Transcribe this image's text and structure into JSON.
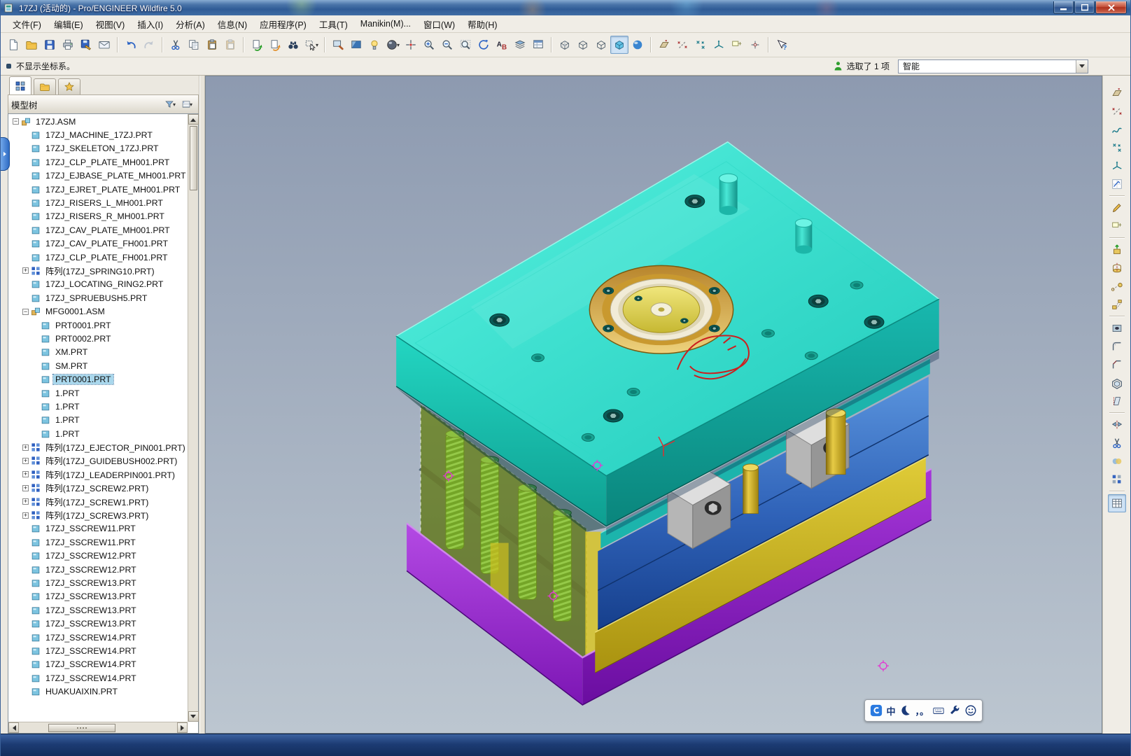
{
  "window": {
    "title": "17ZJ (活动的) - Pro/ENGINEER Wildfire 5.0",
    "controls": [
      {
        "name": "minimize-button",
        "glyph": "minimize"
      },
      {
        "name": "maximize-button",
        "glyph": "maximize"
      },
      {
        "name": "close-button",
        "glyph": "close"
      }
    ]
  },
  "menu_bar": {
    "items": [
      "文件(F)",
      "编辑(E)",
      "视图(V)",
      "插入(I)",
      "分析(A)",
      "信息(N)",
      "应用程序(P)",
      "工具(T)",
      "Manikin(M)...",
      "窗口(W)",
      "帮助(H)"
    ]
  },
  "toolbar": {
    "buttons": [
      {
        "name": "new-file-button",
        "icon": "page"
      },
      {
        "name": "open-button",
        "icon": "folder"
      },
      {
        "name": "save-button",
        "icon": "floppy"
      },
      {
        "name": "print-button",
        "icon": "printer"
      },
      {
        "name": "save-copy-button",
        "icon": "floppypen"
      },
      {
        "name": "send-mail-button",
        "icon": "mail"
      },
      {
        "sep": true
      },
      {
        "name": "undo-button",
        "icon": "undo"
      },
      {
        "name": "redo-button",
        "icon": "redo",
        "disabled": true
      },
      {
        "sep": true
      },
      {
        "name": "cut-button",
        "icon": "cut"
      },
      {
        "name": "copy-button",
        "icon": "copy"
      },
      {
        "name": "paste-button",
        "icon": "paste"
      },
      {
        "name": "paste-special-button",
        "icon": "paste",
        "disabled": true
      },
      {
        "sep": true
      },
      {
        "name": "regenerate-button",
        "icon": "regen"
      },
      {
        "name": "regen-manager-button",
        "icon": "regen2"
      },
      {
        "name": "find-button",
        "icon": "binoculars"
      },
      {
        "name": "select-box-button",
        "icon": "selbox",
        "dropdown": true
      },
      {
        "sep": true
      },
      {
        "name": "repaint-button",
        "icon": "repaint"
      },
      {
        "name": "shading-button",
        "icon": "shade"
      },
      {
        "name": "enhanced-realism-button",
        "icon": "spotlight"
      },
      {
        "name": "render-style-button",
        "icon": "sphere",
        "dropdown": true
      },
      {
        "name": "spin-center-button",
        "icon": "spin"
      },
      {
        "name": "zoom-in-button",
        "icon": "zoomin"
      },
      {
        "name": "zoom-out-button",
        "icon": "zoomout"
      },
      {
        "name": "refit-button",
        "icon": "refit"
      },
      {
        "name": "reorient-button",
        "icon": "orient"
      },
      {
        "name": "annotation-ab-button",
        "icon": "ab"
      },
      {
        "name": "layers-button",
        "icon": "layers"
      },
      {
        "name": "view-manager-button",
        "icon": "viewmgr"
      },
      {
        "sep": true
      },
      {
        "name": "wireframe-button",
        "icon": "cubew"
      },
      {
        "name": "hidden-line-button",
        "icon": "cubeh"
      },
      {
        "name": "no-hidden-button",
        "icon": "cuben"
      },
      {
        "name": "shaded-button",
        "icon": "cubes",
        "active": true
      },
      {
        "name": "realism-button",
        "icon": "ball"
      },
      {
        "sep": true
      },
      {
        "name": "datum-planes-toggle",
        "icon": "dplane"
      },
      {
        "name": "datum-axes-toggle",
        "icon": "daxis"
      },
      {
        "name": "datum-points-toggle",
        "icon": "dpoint"
      },
      {
        "name": "datum-csys-toggle",
        "icon": "dcsys"
      },
      {
        "name": "annotation-display-toggle",
        "icon": "dnote"
      },
      {
        "name": "spin-center-toggle",
        "icon": "dspin"
      },
      {
        "sep": true
      },
      {
        "name": "context-help-button",
        "icon": "help"
      }
    ]
  },
  "status_bar": {
    "message": "不显示坐标系。",
    "selection_status": "选取了 1 项",
    "selection_filter": {
      "label": "智能"
    }
  },
  "navigator": {
    "tabs": [
      {
        "name": "model-tree-tab",
        "icon": "treeicon",
        "active": true
      },
      {
        "name": "folder-browser-tab",
        "icon": "folder",
        "active": false
      },
      {
        "name": "favorites-tab",
        "icon": "star",
        "active": false
      }
    ],
    "header": {
      "title": "模型树",
      "buttons": [
        {
          "name": "tree-filters-button",
          "icon": "funnel"
        },
        {
          "name": "tree-columns-button",
          "icon": "listcols"
        }
      ]
    },
    "tree": [
      {
        "label": "17ZJ.ASM",
        "level": 0,
        "icon": "asm",
        "exp": "-"
      },
      {
        "label": "17ZJ_MACHINE_17ZJ.PRT",
        "level": 1,
        "icon": "prt",
        "exp": ""
      },
      {
        "label": "17ZJ_SKELETON_17ZJ.PRT",
        "level": 1,
        "icon": "prt",
        "exp": ""
      },
      {
        "label": "17ZJ_CLP_PLATE_MH001.PRT",
        "level": 1,
        "icon": "prt",
        "exp": ""
      },
      {
        "label": "17ZJ_EJBASE_PLATE_MH001.PRT",
        "level": 1,
        "icon": "prt",
        "exp": ""
      },
      {
        "label": "17ZJ_EJRET_PLATE_MH001.PRT",
        "level": 1,
        "icon": "prt",
        "exp": ""
      },
      {
        "label": "17ZJ_RISERS_L_MH001.PRT",
        "level": 1,
        "icon": "prt",
        "exp": ""
      },
      {
        "label": "17ZJ_RISERS_R_MH001.PRT",
        "level": 1,
        "icon": "prt",
        "exp": ""
      },
      {
        "label": "17ZJ_CAV_PLATE_MH001.PRT",
        "level": 1,
        "icon": "prt",
        "exp": ""
      },
      {
        "label": "17ZJ_CAV_PLATE_FH001.PRT",
        "level": 1,
        "icon": "prt",
        "exp": ""
      },
      {
        "label": "17ZJ_CLP_PLATE_FH001.PRT",
        "level": 1,
        "icon": "prt",
        "exp": ""
      },
      {
        "label": "阵列(17ZJ_SPRING10.PRT)",
        "level": 1,
        "icon": "pattern",
        "exp": "+"
      },
      {
        "label": "17ZJ_LOCATING_RING2.PRT",
        "level": 1,
        "icon": "prt",
        "exp": ""
      },
      {
        "label": "17ZJ_SPRUEBUSH5.PRT",
        "level": 1,
        "icon": "prt",
        "exp": ""
      },
      {
        "label": "MFG0001.ASM",
        "level": 1,
        "icon": "asm",
        "exp": "-"
      },
      {
        "label": "PRT0001.PRT",
        "level": 2,
        "icon": "prt",
        "exp": ""
      },
      {
        "label": "PRT0002.PRT",
        "level": 2,
        "icon": "prt",
        "exp": ""
      },
      {
        "label": "XM.PRT",
        "level": 2,
        "icon": "prt",
        "exp": ""
      },
      {
        "label": "SM.PRT",
        "level": 2,
        "icon": "prt",
        "exp": ""
      },
      {
        "label": "PRT0001.PRT",
        "level": 2,
        "icon": "prt",
        "exp": "",
        "selected": true
      },
      {
        "label": "1.PRT",
        "level": 2,
        "icon": "prt",
        "exp": ""
      },
      {
        "label": "1.PRT",
        "level": 2,
        "icon": "prt",
        "exp": ""
      },
      {
        "label": "1.PRT",
        "level": 2,
        "icon": "prt",
        "exp": ""
      },
      {
        "label": "1.PRT",
        "level": 2,
        "icon": "prt",
        "exp": ""
      },
      {
        "label": "阵列(17ZJ_EJECTOR_PIN001.PRT)",
        "level": 1,
        "icon": "pattern",
        "exp": "+"
      },
      {
        "label": "阵列(17ZJ_GUIDEBUSH002.PRT)",
        "level": 1,
        "icon": "pattern",
        "exp": "+"
      },
      {
        "label": "阵列(17ZJ_LEADERPIN001.PRT)",
        "level": 1,
        "icon": "pattern",
        "exp": "+"
      },
      {
        "label": "阵列(17ZJ_SCREW2.PRT)",
        "level": 1,
        "icon": "pattern",
        "exp": "+"
      },
      {
        "label": "阵列(17ZJ_SCREW1.PRT)",
        "level": 1,
        "icon": "pattern",
        "exp": "+"
      },
      {
        "label": "阵列(17ZJ_SCREW3.PRT)",
        "level": 1,
        "icon": "pattern",
        "exp": "+"
      },
      {
        "label": "17ZJ_SSCREW11.PRT",
        "level": 1,
        "icon": "prt",
        "exp": ""
      },
      {
        "label": "17ZJ_SSCREW11.PRT",
        "level": 1,
        "icon": "prt",
        "exp": ""
      },
      {
        "label": "17ZJ_SSCREW12.PRT",
        "level": 1,
        "icon": "prt",
        "exp": ""
      },
      {
        "label": "17ZJ_SSCREW12.PRT",
        "level": 1,
        "icon": "prt",
        "exp": ""
      },
      {
        "label": "17ZJ_SSCREW13.PRT",
        "level": 1,
        "icon": "prt",
        "exp": ""
      },
      {
        "label": "17ZJ_SSCREW13.PRT",
        "level": 1,
        "icon": "prt",
        "exp": ""
      },
      {
        "label": "17ZJ_SSCREW13.PRT",
        "level": 1,
        "icon": "prt",
        "exp": ""
      },
      {
        "label": "17ZJ_SSCREW13.PRT",
        "level": 1,
        "icon": "prt",
        "exp": ""
      },
      {
        "label": "17ZJ_SSCREW14.PRT",
        "level": 1,
        "icon": "prt",
        "exp": ""
      },
      {
        "label": "17ZJ_SSCREW14.PRT",
        "level": 1,
        "icon": "prt",
        "exp": ""
      },
      {
        "label": "17ZJ_SSCREW14.PRT",
        "level": 1,
        "icon": "prt",
        "exp": ""
      },
      {
        "label": "17ZJ_SSCREW14.PRT",
        "level": 1,
        "icon": "prt",
        "exp": ""
      },
      {
        "label": "HUAKUAIXIN.PRT",
        "level": 1,
        "icon": "prt",
        "exp": ""
      }
    ]
  },
  "right_toolbar": {
    "buttons": [
      {
        "name": "datum-plane-tool",
        "icon": "dplane"
      },
      {
        "name": "datum-axis-tool",
        "icon": "daxis"
      },
      {
        "name": "sketched-curve-tool",
        "icon": "curve"
      },
      {
        "name": "datum-point-tool",
        "icon": "dpoint"
      },
      {
        "name": "datum-csys-tool",
        "icon": "dcsys"
      },
      {
        "name": "sketch-tool",
        "icon": "sketch"
      },
      {
        "sep": true
      },
      {
        "name": "style-tool",
        "icon": "pencil"
      },
      {
        "name": "annotation-tool",
        "icon": "dnote"
      },
      {
        "sep": true
      },
      {
        "name": "extrude-tool",
        "icon": "extrude"
      },
      {
        "name": "revolve-tool",
        "icon": "revolve"
      },
      {
        "name": "sweep-tool",
        "icon": "sweep"
      },
      {
        "name": "blend-tool",
        "icon": "blend"
      },
      {
        "sep": true
      },
      {
        "name": "hole-tool",
        "icon": "hole"
      },
      {
        "name": "round-tool",
        "icon": "round"
      },
      {
        "name": "chamfer-tool",
        "icon": "chamfer"
      },
      {
        "name": "shell-tool",
        "icon": "shell"
      },
      {
        "name": "draft-tool",
        "icon": "draft"
      },
      {
        "sep": true
      },
      {
        "name": "mirror-tool",
        "icon": "mirror"
      },
      {
        "name": "trim-tool",
        "icon": "cut"
      },
      {
        "name": "merge-tool",
        "icon": "merge"
      },
      {
        "name": "pattern-tool",
        "icon": "patterngrid"
      },
      {
        "sep": true
      },
      {
        "name": "relations-table-tool",
        "icon": "table",
        "active": true
      }
    ]
  },
  "viewport": {
    "model_colors": {
      "top_clamp_plate": "#35e3d0",
      "cavity_plates": "#3f7fd0",
      "support_plate": "#d8c630",
      "ejector_housing": "#cfc32a",
      "base_plate": "#9a2ad2",
      "locating_ring": "#d8a830",
      "springs": "#3a9a3a",
      "part_outline": "#cc1f1f",
      "datum_tag": "#e23ad2"
    }
  },
  "ime_bar": {
    "mode": "中",
    "punctuation": "，。",
    "items": [
      {
        "name": "ime-logo",
        "icon": "imelogo"
      },
      {
        "name": "ime-mode-toggle",
        "label": "中"
      },
      {
        "name": "ime-fullhalf-toggle",
        "icon": "moon"
      },
      {
        "name": "ime-punctuation-toggle",
        "label": "，。"
      },
      {
        "name": "ime-keyboard-button",
        "icon": "kbd"
      },
      {
        "name": "ime-settings-button",
        "icon": "wrench"
      },
      {
        "name": "ime-emoji-button",
        "icon": "smiley"
      }
    ]
  }
}
